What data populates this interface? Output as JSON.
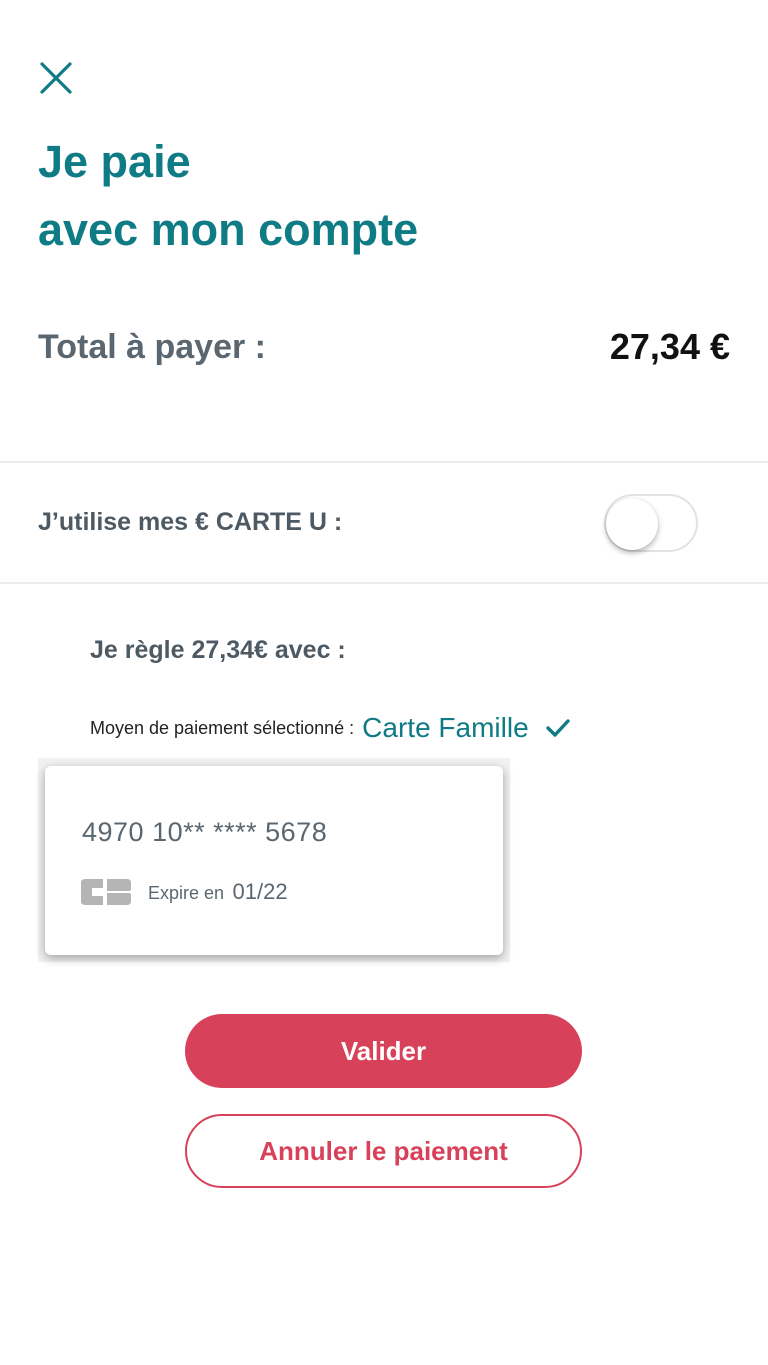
{
  "header": {
    "close_icon": "close-icon",
    "title_line1": "Je paie",
    "title_line2": "avec mon compte"
  },
  "total": {
    "label": "Total à payer :",
    "amount": "27,34 €"
  },
  "carte_u": {
    "label": "J’utilise mes € CARTE U :",
    "toggle_on": false
  },
  "payment": {
    "regle_text": "Je règle 27,34€ avec :",
    "selected_label": "Moyen de paiement sélectionné :",
    "selected_value": "Carte Famille",
    "selected_icon": "checkmark-icon"
  },
  "card": {
    "number": "4970 10** **** 5678",
    "logo": "cb-logo",
    "expiry_label": "Expire en",
    "expiry_date": "01/22"
  },
  "actions": {
    "validate_label": "Valider",
    "cancel_label": "Annuler le paiement"
  },
  "colors": {
    "accent": "#0e7b85",
    "danger": "#d8415a",
    "text_muted": "#5b6770"
  }
}
